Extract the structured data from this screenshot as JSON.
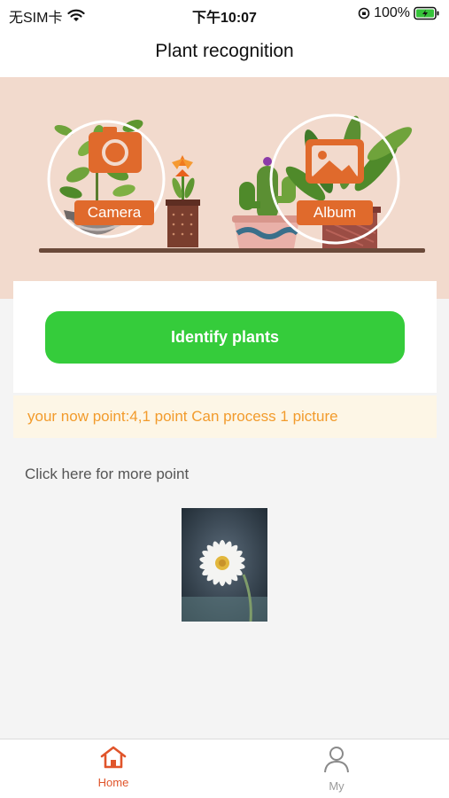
{
  "status_bar": {
    "carrier": "无SIM卡",
    "time": "下午10:07",
    "battery": "100%"
  },
  "nav": {
    "title": "Plant recognition"
  },
  "banner": {
    "camera_label": "Camera",
    "album_label": "Album"
  },
  "actions": {
    "identify_label": "Identify plants"
  },
  "points": {
    "text": "your now point:4,1 point Can process 1 picture"
  },
  "more": {
    "label": "Click here for more point"
  },
  "tabs": [
    {
      "label": "Home",
      "icon": "home-icon",
      "active": true
    },
    {
      "label": "My",
      "icon": "person-icon",
      "active": false
    }
  ],
  "colors": {
    "accent_green": "#35cc3b",
    "accent_orange": "#e0542a",
    "points_text": "#f29b2c",
    "banner_bg": "#f2dacd"
  }
}
